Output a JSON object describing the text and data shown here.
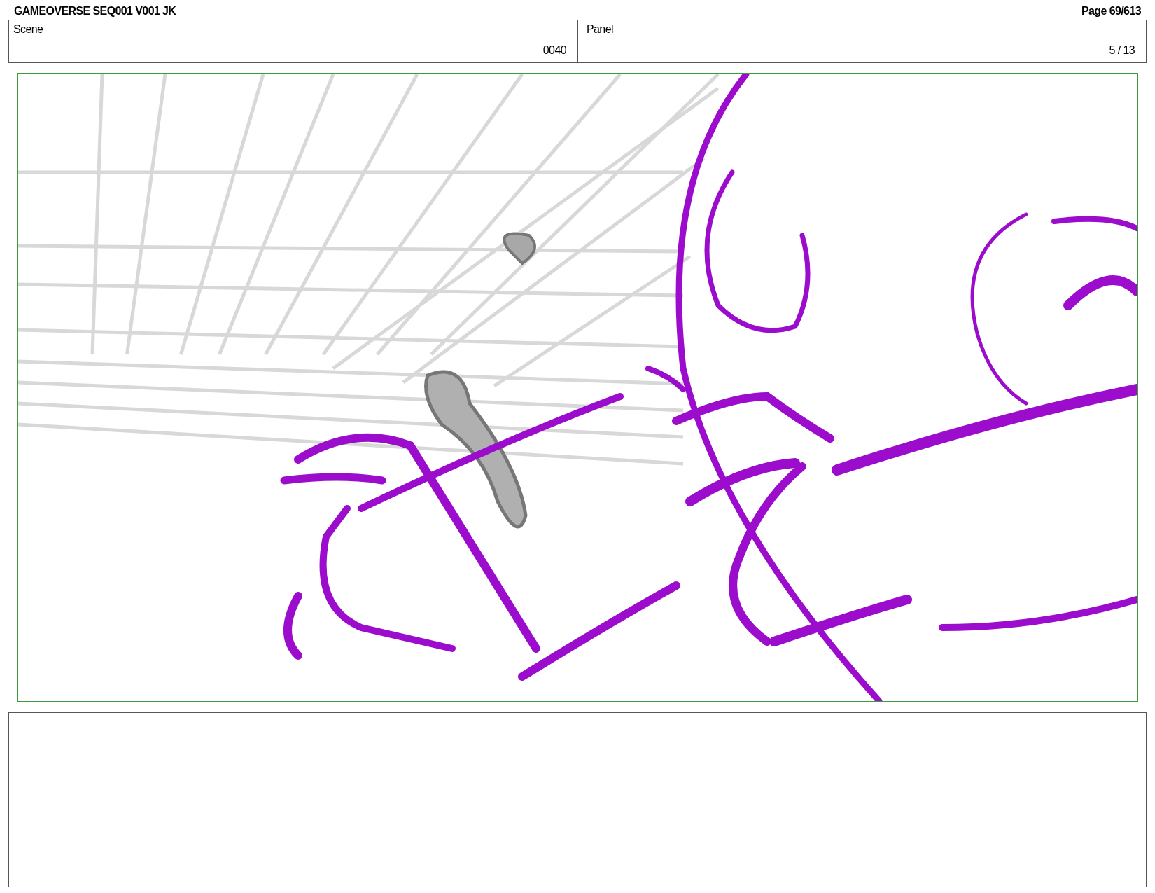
{
  "header": {
    "title": "GAMEOVERSE SEQ001 V001 JK",
    "page": "Page  69/613"
  },
  "fields": [
    {
      "label": "Scene",
      "value": "0040"
    },
    {
      "label": "Panel",
      "value": "5 / 13"
    }
  ],
  "panel": {
    "kind": "sketch"
  }
}
